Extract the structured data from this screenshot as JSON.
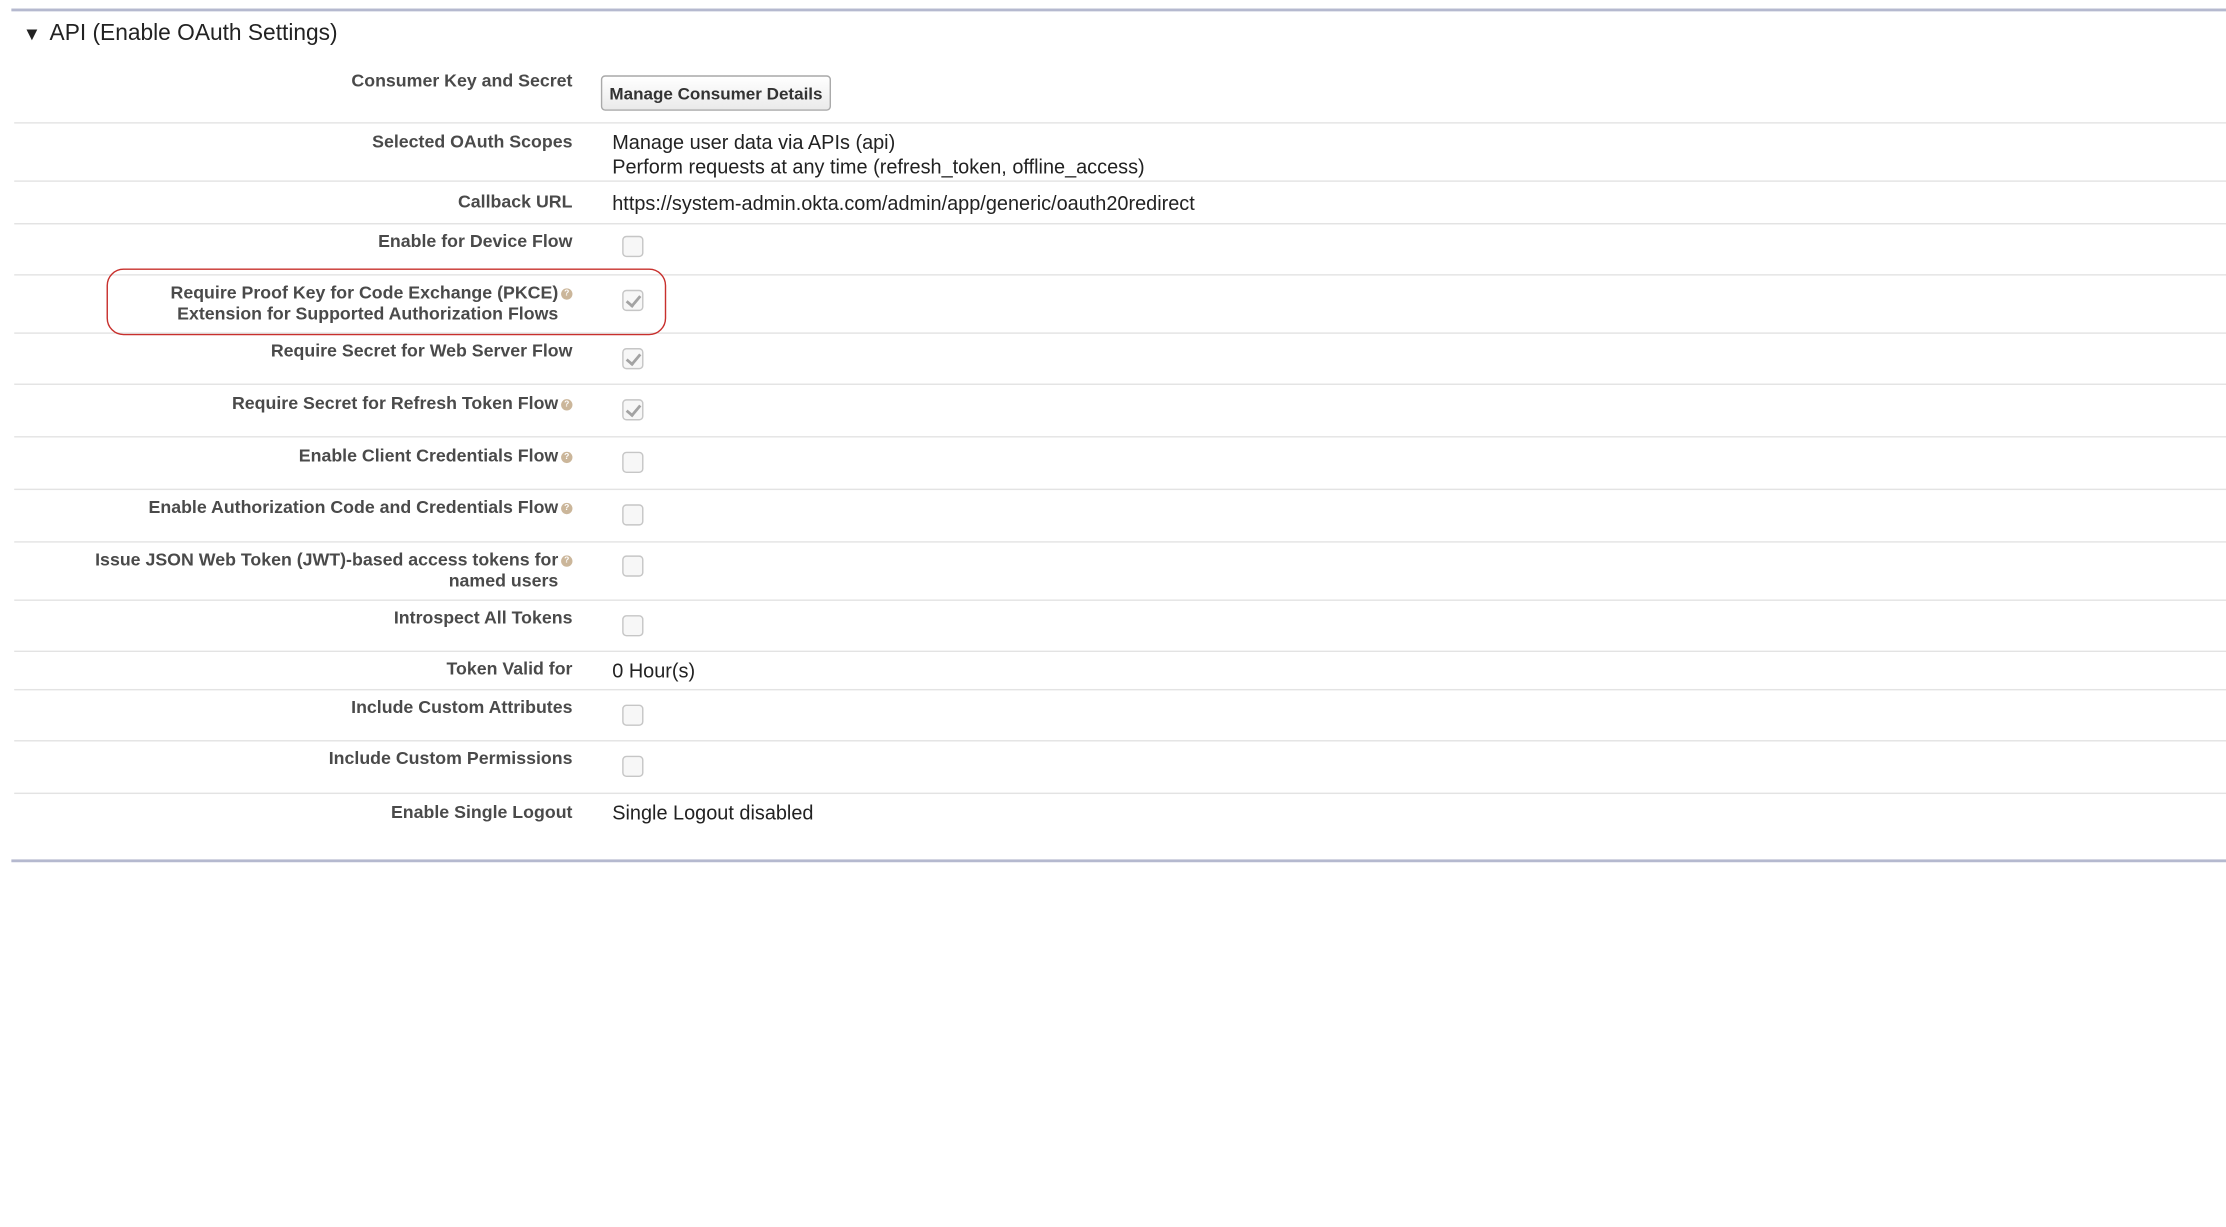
{
  "section": {
    "toggle_icon": "triangle-down-icon",
    "title": "API (Enable OAuth Settings)"
  },
  "consumer": {
    "label": "Consumer Key and Secret",
    "button": "Manage Consumer Details"
  },
  "scopes": {
    "label": "Selected OAuth Scopes",
    "values": [
      "Manage user data via APIs (api)",
      "Perform requests at any time (refresh_token, offline_access)"
    ]
  },
  "callback": {
    "label": "Callback URL",
    "value": "https://system-admin.okta.com/admin/app/generic/oauth20redirect"
  },
  "device_flow": {
    "label": "Enable for Device Flow",
    "checked": false
  },
  "pkce": {
    "label_line1": "Require Proof Key for Code Exchange (PKCE)",
    "label_line2": "Extension for Supported Authorization Flows",
    "checked": true,
    "highlighted": true
  },
  "secret_web_server": {
    "label": "Require Secret for Web Server Flow",
    "checked": true
  },
  "secret_refresh": {
    "label": "Require Secret for Refresh Token Flow",
    "checked": true
  },
  "client_credentials": {
    "label": "Enable Client Credentials Flow",
    "checked": false
  },
  "auth_code_credentials": {
    "label": "Enable Authorization Code and Credentials Flow",
    "checked": false
  },
  "jwt_tokens": {
    "label_line1": "Issue JSON Web Token (JWT)-based access tokens for",
    "label_line2": "named users",
    "checked": false
  },
  "introspect": {
    "label": "Introspect All Tokens",
    "checked": false
  },
  "token_valid": {
    "label": "Token Valid for",
    "value": "0 Hour(s)"
  },
  "custom_attributes": {
    "label": "Include Custom Attributes",
    "checked": false
  },
  "custom_permissions": {
    "label": "Include Custom Permissions",
    "checked": false
  },
  "single_logout": {
    "label": "Enable Single Logout",
    "value": "Single Logout disabled"
  },
  "colors": {
    "highlight_border": "#c8302d",
    "section_rule": "#b5b9cf",
    "help_icon": "#cbb69a"
  }
}
